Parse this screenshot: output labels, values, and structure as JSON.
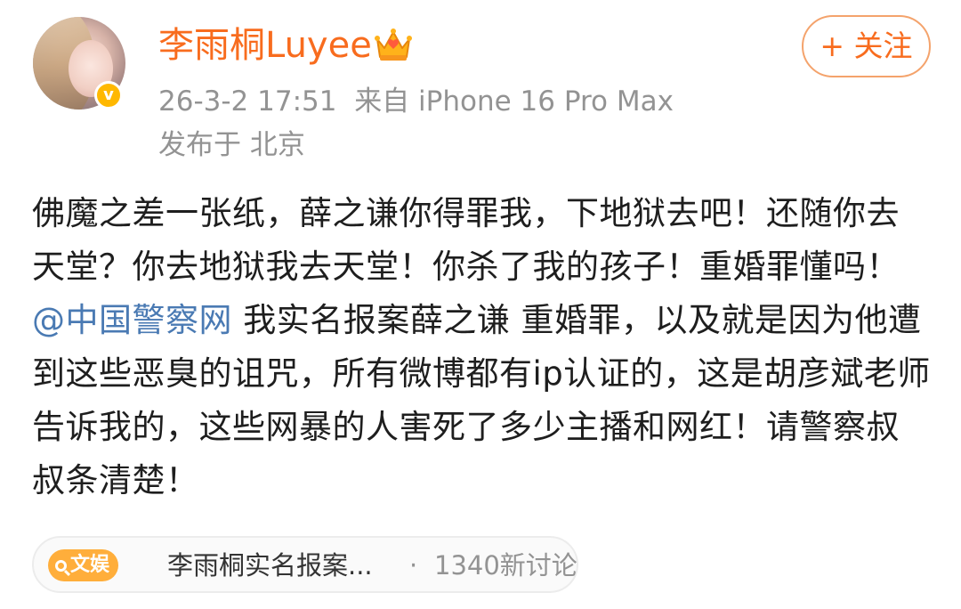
{
  "user": {
    "name": "李雨桐Luyee",
    "verified_mark": "v",
    "avatar_icon": "avatar-photo",
    "crown_icon": "vip-crown-icon"
  },
  "post_meta": {
    "timestamp": "26-3-2 17:51",
    "source": "来自 iPhone 16 Pro Max",
    "location": "发布于 北京"
  },
  "follow_button": {
    "label": "+ 关注"
  },
  "post": {
    "text_before_mention": "佛魔之差一张纸，薛之谦你得罪我，下地狱去吧！还随你去天堂？你去地狱我去天堂！你杀了我的孩子！重婚罪懂吗！",
    "mention": "@中国警察网",
    "text_after_mention": " 我实名报案薛之谦 重婚罪，以及就是因为他遭到这些恶臭的诅咒，所有微博都有ip认证的，这是胡彦斌老师告诉我的，这些网暴的人害死了多少主播和网红！请警察叔叔条清楚！"
  },
  "topic": {
    "tag": "文娱",
    "title": "李雨桐实名报案...",
    "separator": "·",
    "discussion_count": "1340新讨论"
  },
  "colors": {
    "username": "#f86c1e",
    "meta": "#939393",
    "mention": "#4a7ab3",
    "verified": "#ffb800",
    "topic_tag": "#ffae3b"
  }
}
